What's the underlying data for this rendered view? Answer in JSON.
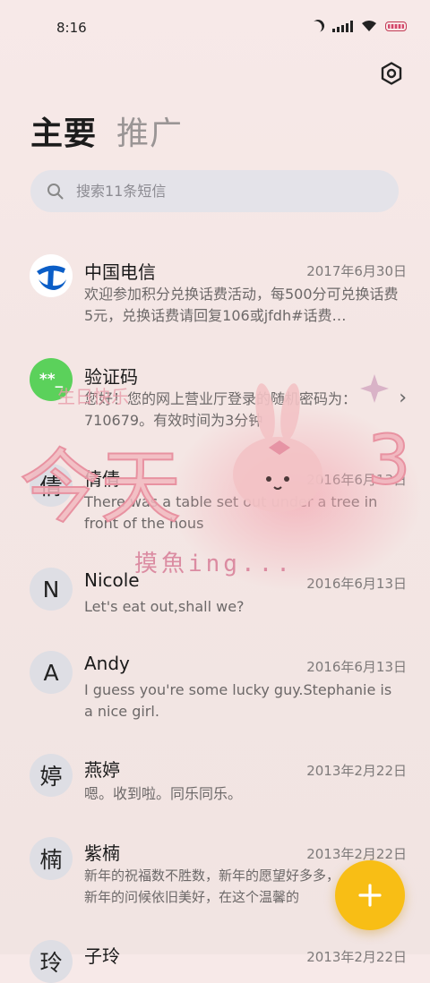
{
  "status_bar": {
    "time": "8:16"
  },
  "tabs": [
    {
      "label": "主要"
    },
    {
      "label": "推广"
    }
  ],
  "search": {
    "placeholder": "搜索11条短信"
  },
  "conversations": [
    {
      "avatar_text": "",
      "name": "中国电信",
      "date": "2017年6月30日",
      "preview": "欢迎参加积分兑换话费活动，每500分可兑换话费5元，兑换话费请回复106或jfdh#话费…"
    },
    {
      "avatar_text": "**_",
      "name": "验证码",
      "date": "",
      "preview": "您好！您的网上营业厅登录的随机密码为：710679。有效时间为3分钟"
    },
    {
      "avatar_text": "倩",
      "name": "倩倩",
      "date": "2016年6月13日",
      "preview": "There was a table set out under a tree in front of the hous"
    },
    {
      "avatar_text": "N",
      "name": "Nicole",
      "date": "2016年6月13日",
      "preview": "Let's eat out,shall we?"
    },
    {
      "avatar_text": "A",
      "name": "Andy",
      "date": "2016年6月13日",
      "preview": "I guess you're some lucky guy.Stephanie is a nice girl."
    },
    {
      "avatar_text": "婷",
      "name": "燕婷",
      "date": "2013年2月22日",
      "preview": "嗯。收到啦。同乐同乐。"
    },
    {
      "avatar_text": "楠",
      "name": "紫楠",
      "date": "2013年2月22日",
      "preview": "新年的祝福数不胜数，新年的愿望好多多，新年的问候依旧美好，在这个温馨的"
    },
    {
      "avatar_text": "玲",
      "name": "子玲",
      "date": "2013年2月22日",
      "preview": ""
    }
  ],
  "overlay": {
    "line1": "今天",
    "line2": "摸魚ing...",
    "small": "生日快乐"
  },
  "colors": {
    "fab": "#f8be15",
    "verify_avatar": "#5bd15b",
    "telecom_blue": "#0b5ec7"
  }
}
